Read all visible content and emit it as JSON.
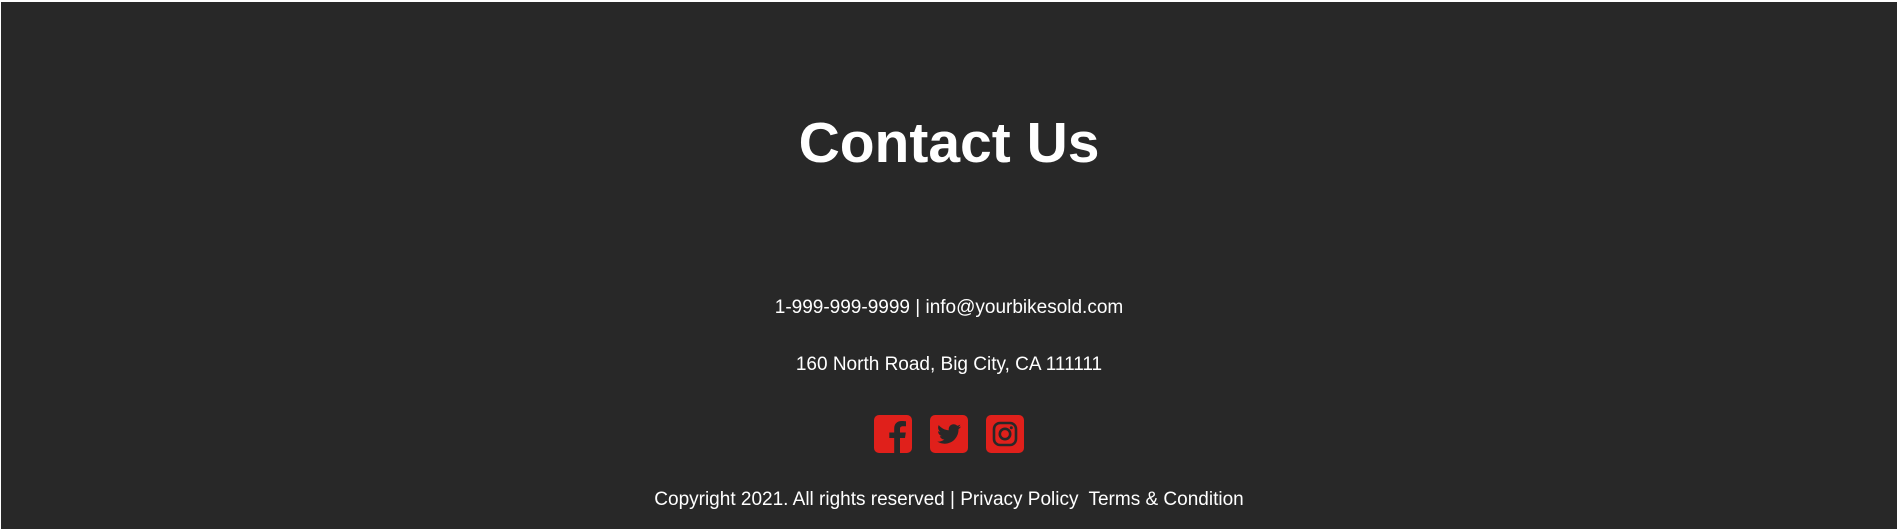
{
  "colors": {
    "background": "#282828",
    "text": "#ffffff",
    "accent": "#e0201b"
  },
  "contact": {
    "title": "Contact Us",
    "phone": "1-999-999-9999",
    "separator": "|",
    "email": "info@yourbikesold.com",
    "address": "160 North Road, Big City, CA 111111"
  },
  "social": [
    {
      "icon": "facebook-icon"
    },
    {
      "icon": "twitter-icon"
    },
    {
      "icon": "instagram-icon"
    }
  ],
  "footer": {
    "copyright": "Copyright 2021. All rights reserved",
    "separator": "|",
    "privacy_label": "Privacy Policy",
    "terms_label": "Terms & Condition"
  }
}
